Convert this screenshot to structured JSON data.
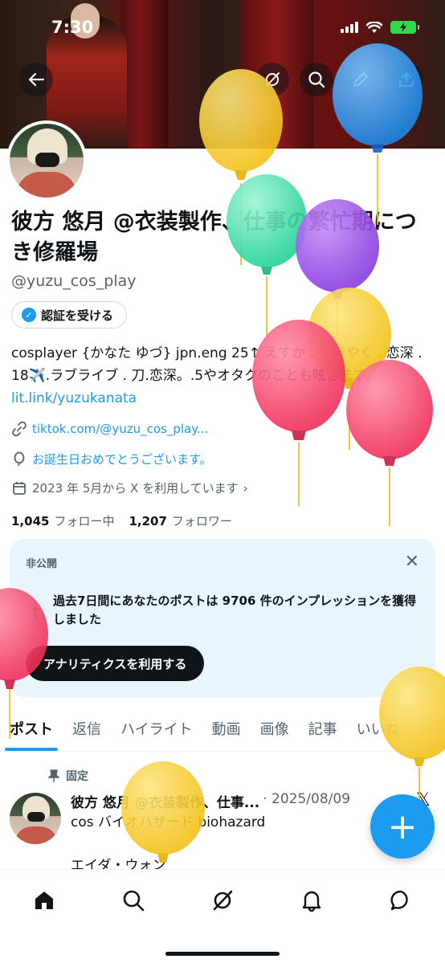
{
  "status_bar": {
    "time": "7:30"
  },
  "profile": {
    "display_name": "彼方 悠月 @衣装製作、仕事の繁忙期につき修羅場",
    "handle": "@yuzu_cos_play",
    "verify_button": "認証を受ける",
    "bio_text": "cosplayer {かなた ゆづ} jpn.eng 25↑ えすか . まほやく . 恋深 . 18✈️.ラブライブ . 刀.恋深。.5やオタクのことも呟きます。",
    "bio_link": "lit.link/yuzukanata",
    "website": "tiktok.com/@yuzu_cos_play...",
    "birthday": "お誕生日おめでとうございます。",
    "joined": "2023 年 5月から X を利用しています",
    "following_count": "1,045",
    "following_label": "フォロー中",
    "followers_count": "1,207",
    "followers_label": "フォロワー"
  },
  "private_card": {
    "label": "非公開",
    "message": "過去7日間にあなたのポストは 9706 件のインプレッションを獲得しました",
    "button": "アナリティクスを利用する"
  },
  "tabs": [
    {
      "label": "ポスト",
      "active": true
    },
    {
      "label": "返信",
      "active": false
    },
    {
      "label": "ハイライト",
      "active": false
    },
    {
      "label": "動画",
      "active": false
    },
    {
      "label": "画像",
      "active": false
    },
    {
      "label": "記事",
      "active": false
    },
    {
      "label": "いいね",
      "active": false
    }
  ],
  "post": {
    "pinned_label": "固定",
    "author": "彼方 悠月 @衣装製作、仕事...",
    "date": "· 2025/08/09",
    "line1": "cos バイオハザード biohazard",
    "line2": "エイダ・ウォン"
  },
  "colors": {
    "accent": "#1d9bf0",
    "text": "#0f1419",
    "muted": "#536471",
    "card_bg": "#e8f5fd"
  },
  "icons": [
    "back-arrow-icon",
    "grok-icon",
    "search-icon",
    "edit-icon",
    "share-icon",
    "verified-badge-icon",
    "link-icon",
    "balloon-icon",
    "calendar-icon",
    "close-icon",
    "pin-icon",
    "x-logo-icon",
    "compose-plus-icon",
    "home-icon",
    "notifications-bell-icon",
    "messages-icon"
  ]
}
